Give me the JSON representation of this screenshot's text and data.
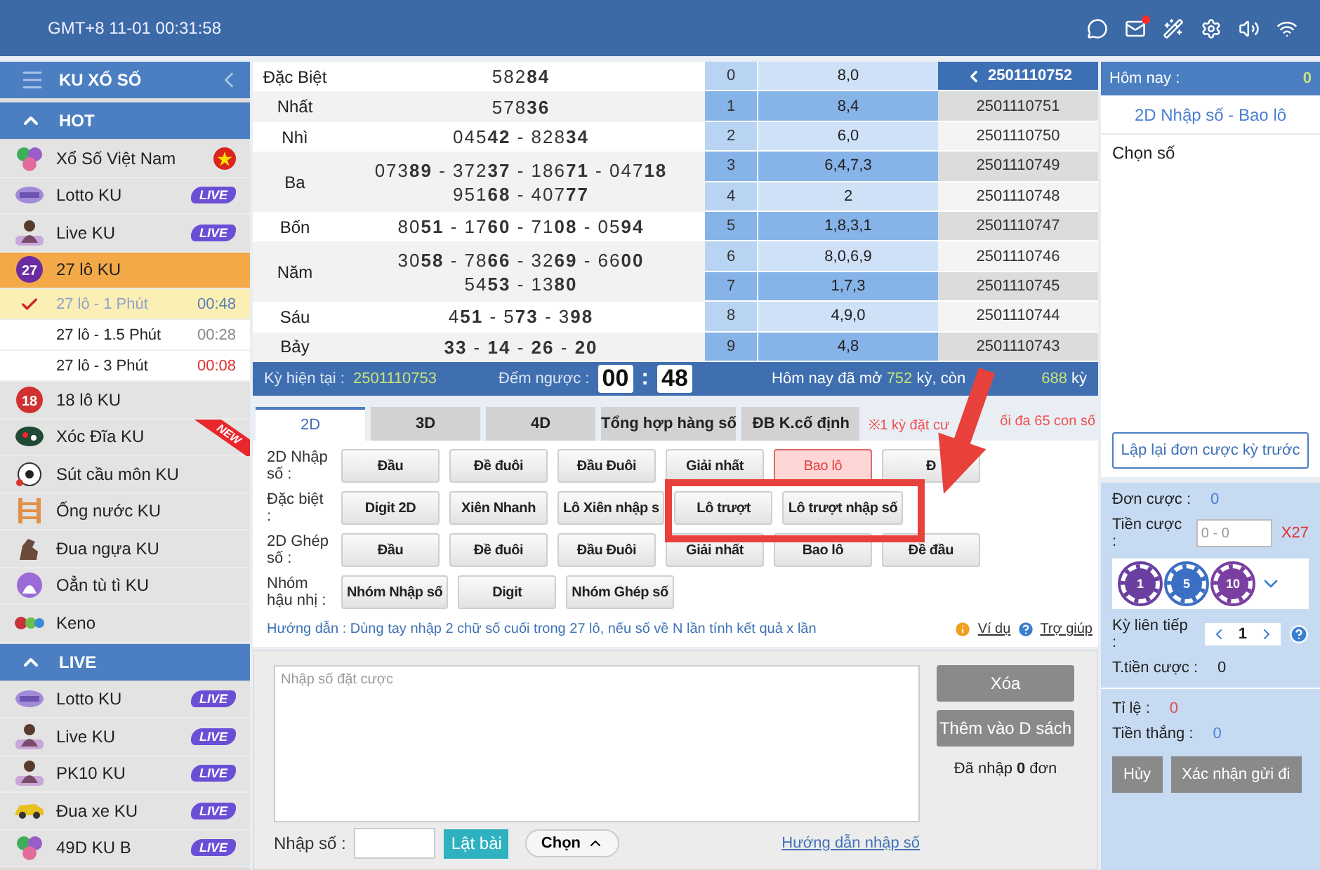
{
  "topbar": {
    "clock": "GMT+8 11-01 00:31:58",
    "mail_unread": true
  },
  "sidebar": {
    "title": "KU XỔ SỐ",
    "sections": [
      {
        "label": "HOT",
        "expanded": true,
        "items": [
          {
            "label": "Xổ Số Việt Nam",
            "selected": false,
            "icon": {
              "kind": "balls"
            },
            "badge": {
              "kind": "flag"
            }
          },
          {
            "label": "Lotto KU",
            "selected": false,
            "icon": {
              "kind": "machine"
            },
            "badge": {
              "kind": "live",
              "text": "LIVE"
            }
          },
          {
            "label": "Live KU",
            "selected": false,
            "icon": {
              "kind": "figure"
            },
            "badge": {
              "kind": "live",
              "text": "LIVE"
            }
          },
          {
            "label": "27 lô KU",
            "selected": true,
            "icon": {
              "kind": "number",
              "text": "27",
              "color": "#6a2ca0"
            },
            "children": [
              {
                "label": "27 lô - 1 Phút",
                "time": "00:48",
                "selected": true,
                "color": "#5a7fb5"
              },
              {
                "label": "27 lô - 1.5 Phút",
                "time": "00:28",
                "selected": false,
                "color": "#888888"
              },
              {
                "label": "27 lô - 3 Phút",
                "time": "00:08",
                "selected": false,
                "color": "#e03030"
              }
            ]
          },
          {
            "label": "18 lô KU",
            "selected": false,
            "icon": {
              "kind": "number",
              "text": "18",
              "color": "#d03030"
            }
          },
          {
            "label": "Xóc Đĩa KU",
            "selected": false,
            "icon": {
              "kind": "plate"
            },
            "badge": {
              "kind": "new",
              "text": "NEW"
            }
          },
          {
            "label": "Sút cầu môn KU",
            "selected": false,
            "icon": {
              "kind": "soccer"
            }
          },
          {
            "label": "Ống nước KU",
            "selected": false,
            "icon": {
              "kind": "ladder"
            }
          },
          {
            "label": "Đua ngựa KU",
            "selected": false,
            "icon": {
              "kind": "horse"
            }
          },
          {
            "label": "Oẳn tù tì KU",
            "selected": false,
            "icon": {
              "kind": "hand"
            }
          },
          {
            "label": "Keno",
            "selected": false,
            "icon": {
              "kind": "keno"
            }
          }
        ]
      },
      {
        "label": "LIVE",
        "expanded": true,
        "items": [
          {
            "label": "Lotto KU",
            "selected": false,
            "icon": {
              "kind": "machine"
            },
            "badge": {
              "kind": "live",
              "text": "LIVE"
            }
          },
          {
            "label": "Live KU",
            "selected": false,
            "icon": {
              "kind": "figure"
            },
            "badge": {
              "kind": "live",
              "text": "LIVE"
            }
          },
          {
            "label": "PK10 KU",
            "selected": false,
            "icon": {
              "kind": "figure"
            },
            "badge": {
              "kind": "live",
              "text": "LIVE"
            }
          },
          {
            "label": "Đua xe KU",
            "selected": false,
            "icon": {
              "kind": "car"
            },
            "badge": {
              "kind": "live",
              "text": "LIVE"
            }
          },
          {
            "label": "49D KU B",
            "selected": false,
            "icon": {
              "kind": "balls"
            },
            "badge": {
              "kind": "live",
              "text": "LIVE"
            }
          }
        ]
      }
    ]
  },
  "results": {
    "prizes": [
      {
        "name": "Đặc Biệt",
        "lines": [
          "582**84**"
        ]
      },
      {
        "name": "Nhất",
        "lines": [
          "578**36**"
        ]
      },
      {
        "name": "Nhì",
        "lines": [
          "045**42** - 828**34**"
        ]
      },
      {
        "name": "Ba",
        "lines": [
          "073**89** - 372**37** - 186**71** - 047**18**",
          "951**68** - 407**77**"
        ]
      },
      {
        "name": "Bốn",
        "lines": [
          "80**51** - 17**60** - 71**08** - 05**94**"
        ]
      },
      {
        "name": "Năm",
        "lines": [
          "30**58** - 78**66** - 32**69** - 66**00**",
          "54**53** - 13**80**"
        ]
      },
      {
        "name": "Sáu",
        "lines": [
          "4**51** - 5**73** - 3**98**"
        ]
      },
      {
        "name": "Bảy",
        "lines": [
          "**33** - **14** - **26** - **20**"
        ]
      }
    ],
    "digits": [
      {
        "digit": "0",
        "values": "8,0"
      },
      {
        "digit": "1",
        "values": "8,4"
      },
      {
        "digit": "2",
        "values": "6,0"
      },
      {
        "digit": "3",
        "values": "6,4,7,3"
      },
      {
        "digit": "4",
        "values": "2"
      },
      {
        "digit": "5",
        "values": "1,8,3,1"
      },
      {
        "digit": "6",
        "values": "8,0,6,9"
      },
      {
        "digit": "7",
        "values": "1,7,3"
      },
      {
        "digit": "8",
        "values": "4,9,0"
      },
      {
        "digit": "9",
        "values": "4,8"
      }
    ],
    "periods": [
      {
        "label": "2501110752",
        "selected": true
      },
      {
        "label": "2501110751",
        "selected": false
      },
      {
        "label": "2501110750",
        "selected": false
      },
      {
        "label": "2501110749",
        "selected": false
      },
      {
        "label": "2501110748",
        "selected": false
      },
      {
        "label": "2501110747",
        "selected": false
      },
      {
        "label": "2501110746",
        "selected": false
      },
      {
        "label": "2501110745",
        "selected": false
      },
      {
        "label": "2501110744",
        "selected": false
      },
      {
        "label": "2501110743",
        "selected": false
      }
    ]
  },
  "status": {
    "current_label": "Kỳ hiện tại :",
    "current": "2501110753",
    "countdown_label": "Đếm ngược :",
    "countdown": [
      "00",
      "48"
    ],
    "countdown_sep": ":",
    "summary": [
      "Hôm nay đã mở **752** kỳ, còn",
      "**688** kỳ"
    ]
  },
  "tabs": [
    {
      "label": "2D",
      "selected": true
    },
    {
      "label": "3D",
      "selected": false
    },
    {
      "label": "4D",
      "selected": false
    },
    {
      "label": "Tổng hợp hàng số",
      "selected": false
    },
    {
      "label": "ĐB K.cố định",
      "selected": false
    }
  ],
  "note": [
    "※1 kỳ đặt cư",
    "ối đa 65 con số"
  ],
  "options": [
    {
      "label": "2D Nhập số :",
      "buttons": [
        {
          "label": "Đầu",
          "selected": false
        },
        {
          "label": "Đề đuôi",
          "selected": false
        },
        {
          "label": "Đầu Đuôi",
          "selected": false
        },
        {
          "label": "Giải nhất",
          "selected": false
        },
        {
          "label": "Bao lô",
          "selected": true
        },
        {
          "label": "Đ",
          "selected": false
        }
      ]
    },
    {
      "label": "Đặc biệt :",
      "buttons": [
        {
          "label": "Digit 2D",
          "selected": false
        },
        {
          "label": "Xiên Nhanh",
          "selected": false
        },
        {
          "label": "Lô Xiên nhập s",
          "selected": false
        },
        {
          "label": "Lô trượt",
          "selected": false
        },
        {
          "label": "Lô trượt nhập số",
          "selected": false
        }
      ]
    },
    {
      "label": "2D Ghép số :",
      "buttons": [
        {
          "label": "Đầu",
          "selected": false
        },
        {
          "label": "Đề đuôi",
          "selected": false
        },
        {
          "label": "Đầu Đuôi",
          "selected": false
        },
        {
          "label": "Giải nhất",
          "selected": false
        },
        {
          "label": "Bao lô",
          "selected": false
        },
        {
          "label": "Đề đầu",
          "selected": false
        }
      ]
    },
    {
      "label": "Nhóm hậu nhị :",
      "buttons": [
        {
          "label": "Nhóm Nhập số",
          "selected": false
        },
        {
          "label": "Digit",
          "selected": false
        },
        {
          "label": "Nhóm Ghép số",
          "selected": false
        }
      ]
    }
  ],
  "guide": {
    "text": "Hướng dẫn : Dùng tay nhập 2 chữ số cuối trong 27 lô, nếu số về N lần tính kết quả x lần",
    "example": "Ví dụ",
    "help": "Trợ giúp"
  },
  "entry": {
    "placeholder": "Nhập số đặt cược",
    "clear": "Xóa",
    "add": "Thêm vào D sách",
    "count": "Đã nhập **0** đơn",
    "number_label": "Nhập số :",
    "flip": "Lật bài",
    "choose": "Chọn",
    "howto": "Hướng dẫn nhập số"
  },
  "panel": {
    "today_label": "Hôm nay :",
    "today_value": "0",
    "mode": "2D Nhập số - Bao lô",
    "picked_label": "Chọn số",
    "repeat": "Lập lại đơn cược kỳ trước",
    "orders_label": "Đơn cược :",
    "orders": "0",
    "stake_label": "Tiền cược :",
    "stake_placeholder": "0 - 0",
    "multiplier": "X27",
    "chips": [
      {
        "label": "1",
        "color": "#6b3fa0"
      },
      {
        "label": "5",
        "color": "#3a6fc4"
      },
      {
        "label": "10",
        "color": "#7a3fa0"
      }
    ],
    "streak_label": "Kỳ liên tiếp :",
    "streak": "1",
    "total_label": "T.tiền cược :",
    "total": "0",
    "stats": [
      {
        "label": "Tỉ lệ :",
        "value": "0",
        "color": "#e05050"
      },
      {
        "label": "Tiền thắng :",
        "value": "0",
        "color": "#4a7fd0"
      }
    ],
    "cancel": "Hủy",
    "submit": "Xác nhận gửi đi"
  }
}
